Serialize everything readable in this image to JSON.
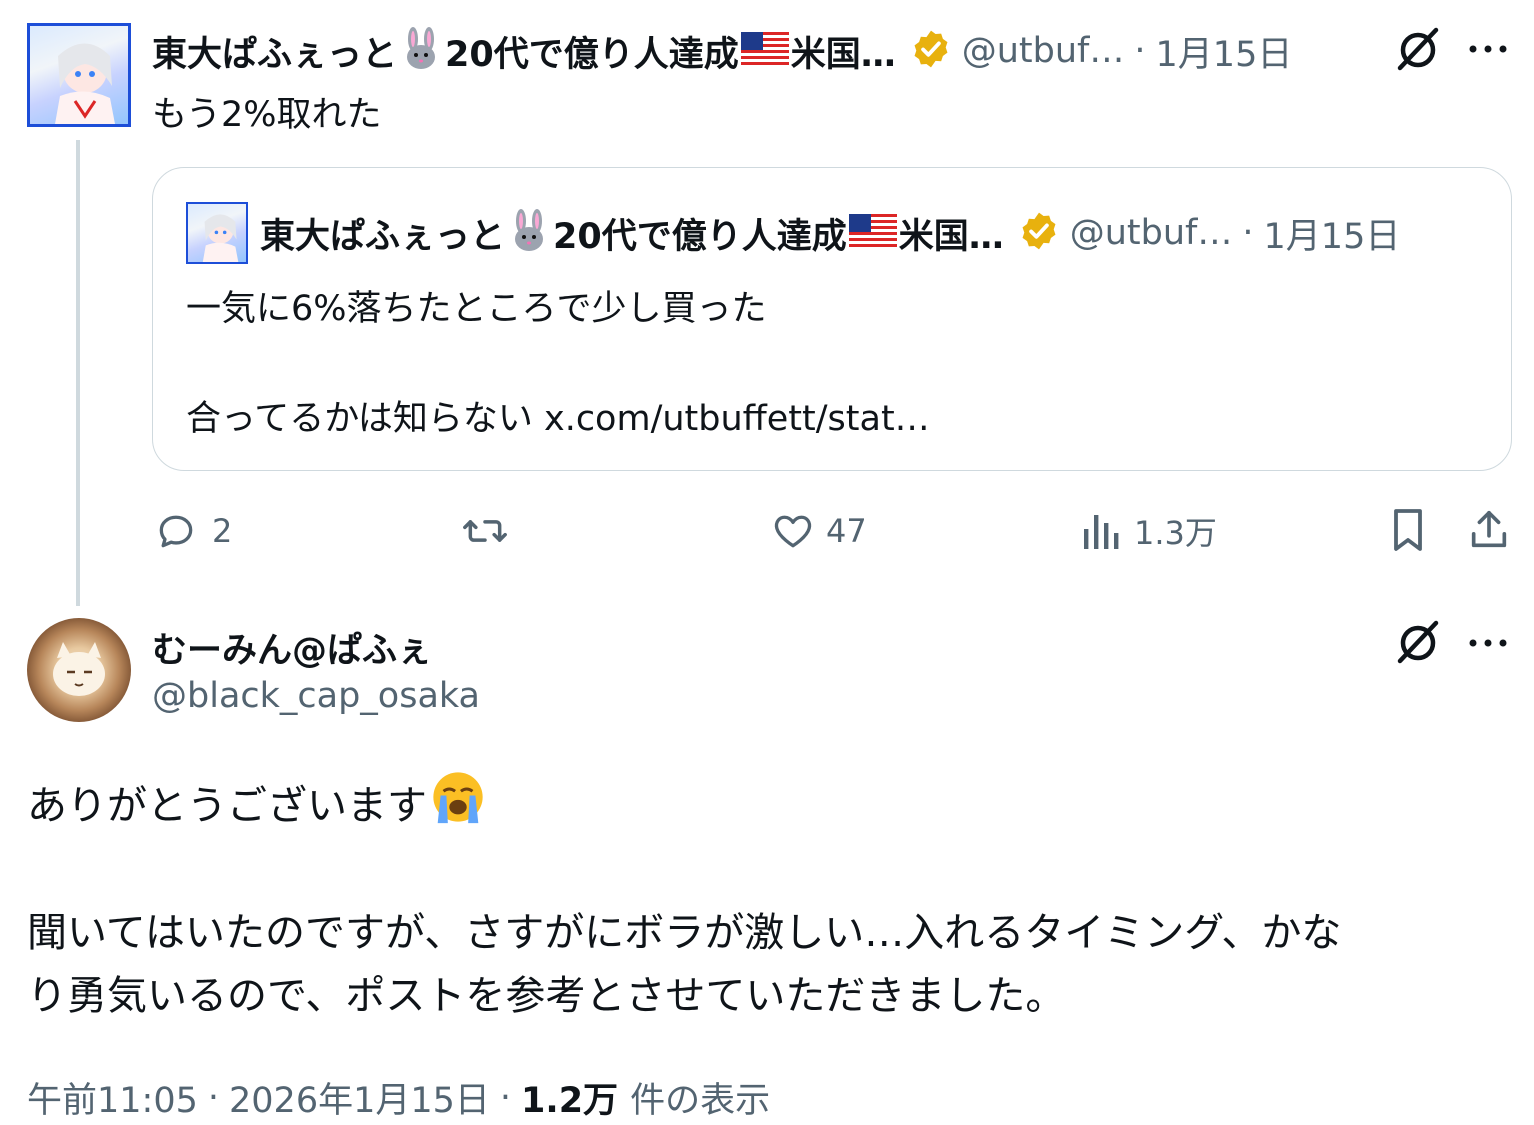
{
  "tweet1": {
    "author_name": "東大ぱふぇっと",
    "author_name_suffix_a": "20代で億り人達成",
    "author_name_suffix_b": "米国…",
    "handle": "@utbuf…",
    "separator": "·",
    "date": "1月15日",
    "text": "もう2%取れた",
    "icons": [
      "grok-icon",
      "more-icon"
    ]
  },
  "quote": {
    "author_name": "東大ぱふぇっと",
    "author_name_suffix_a": "20代で億り人達成",
    "author_name_suffix_b": "米国…",
    "handle": "@utbuf…",
    "separator": "·",
    "date": "1月15日",
    "line1": "一気に6%落ちたところで少し買った",
    "line2": "合ってるかは知らない x.com/utbuffett/stat…"
  },
  "actions": {
    "reply_count": "2",
    "retweet_count": "",
    "like_count": "47",
    "view_count": "1.3万"
  },
  "reply": {
    "author_name": "むーみん@ぱふぇ",
    "handle": "@black_cap_osaka",
    "text_line1": "ありがとうございます",
    "text_line2": "聞いてはいたのですが、さすがにボラが激しい…入れるタイミング、かな",
    "text_line3": "り勇気いるので、ポストを参考とさせていただきました。",
    "time": "午前11:05",
    "separator": "·",
    "date": "2026年1月15日",
    "views_count": "1.2万",
    "views_label": "件の表示"
  },
  "colors": {
    "text": "#0f1419",
    "secondary": "#536471",
    "border": "#cfd9de",
    "verified": "#e8b10e"
  }
}
